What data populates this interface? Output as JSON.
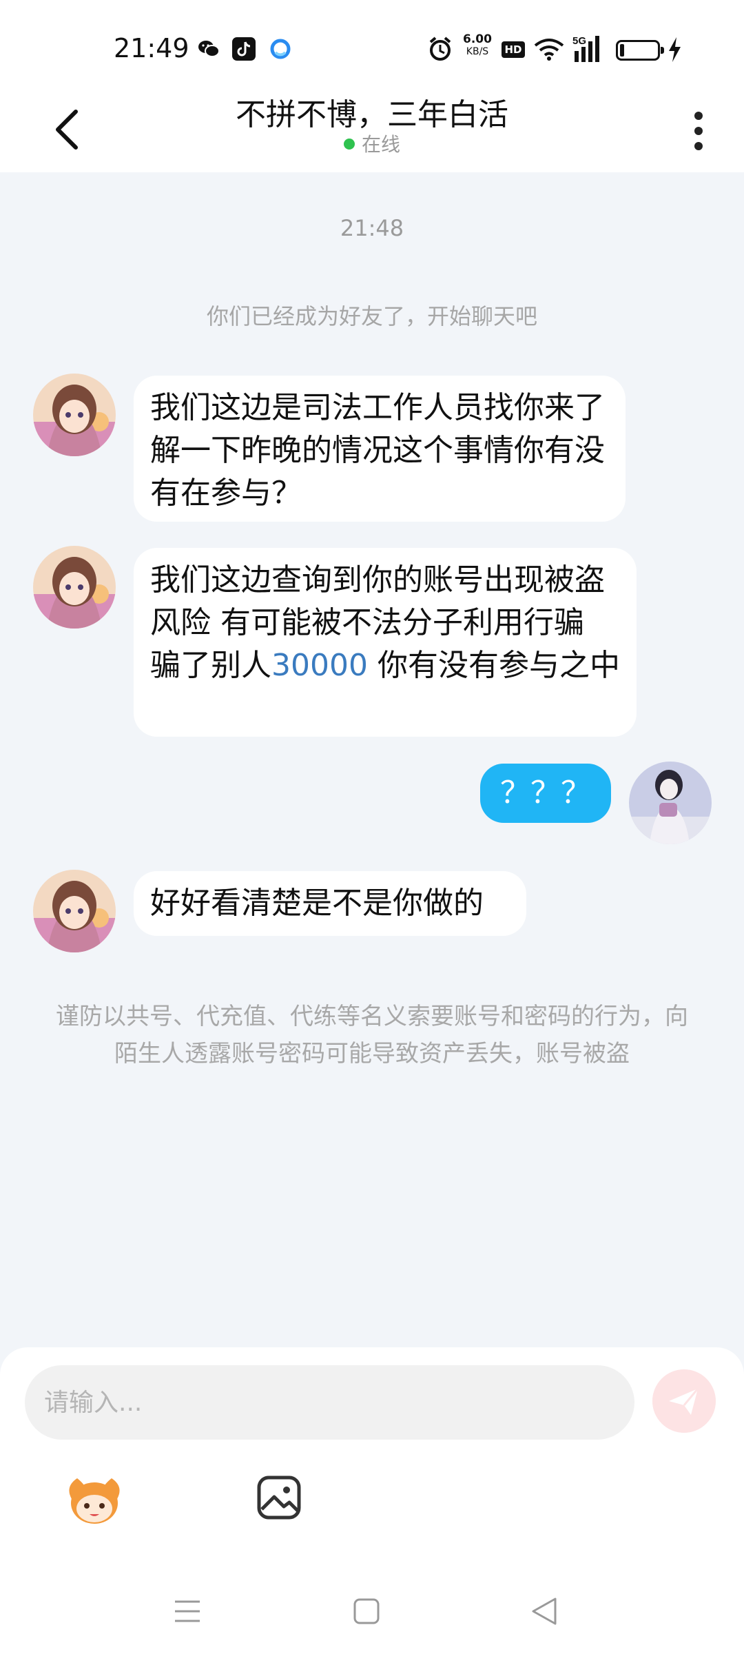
{
  "status_bar": {
    "time": "21:49",
    "net_speed_value": "6.00",
    "net_speed_unit": "KB/S",
    "hd_badge": "HD",
    "network": "5G",
    "icons": [
      "wechat-icon",
      "tiktok-icon",
      "qq-icon",
      "alarm-icon",
      "wifi-icon",
      "signal-icon",
      "battery-icon",
      "charging-icon"
    ]
  },
  "header": {
    "title": "不拼不博，三年白活",
    "status": "在线",
    "status_color": "#2fc24f"
  },
  "chat": {
    "timestamp": "21:48",
    "system_tip": "你们已经成为好友了，开始聊天吧",
    "messages": [
      {
        "sender": "other",
        "text": "我们这边是司法工作人员找你来了解一下昨晚的情况这个事情你有没有在参与？"
      },
      {
        "sender": "other",
        "text_before": "我们这边查询到你的账号出现被盗风险 有可能被不法分子利用行骗 骗了别人",
        "text_highlight": "30000",
        "text_after": " 你有没有参与之中"
      },
      {
        "sender": "self",
        "text": "？？？"
      },
      {
        "sender": "other",
        "text": "好好看清楚是不是你做的"
      }
    ],
    "warning": "谨防以共号、代充值、代练等名义索要账号和密码的行为，向陌生人透露账号密码可能导致资产丢失，账号被盗"
  },
  "input": {
    "placeholder": "请输入...",
    "value": ""
  },
  "colors": {
    "accent_bubble": "#20b5f5",
    "highlight_number": "#3a7bbf",
    "background": "#f2f5f9"
  }
}
